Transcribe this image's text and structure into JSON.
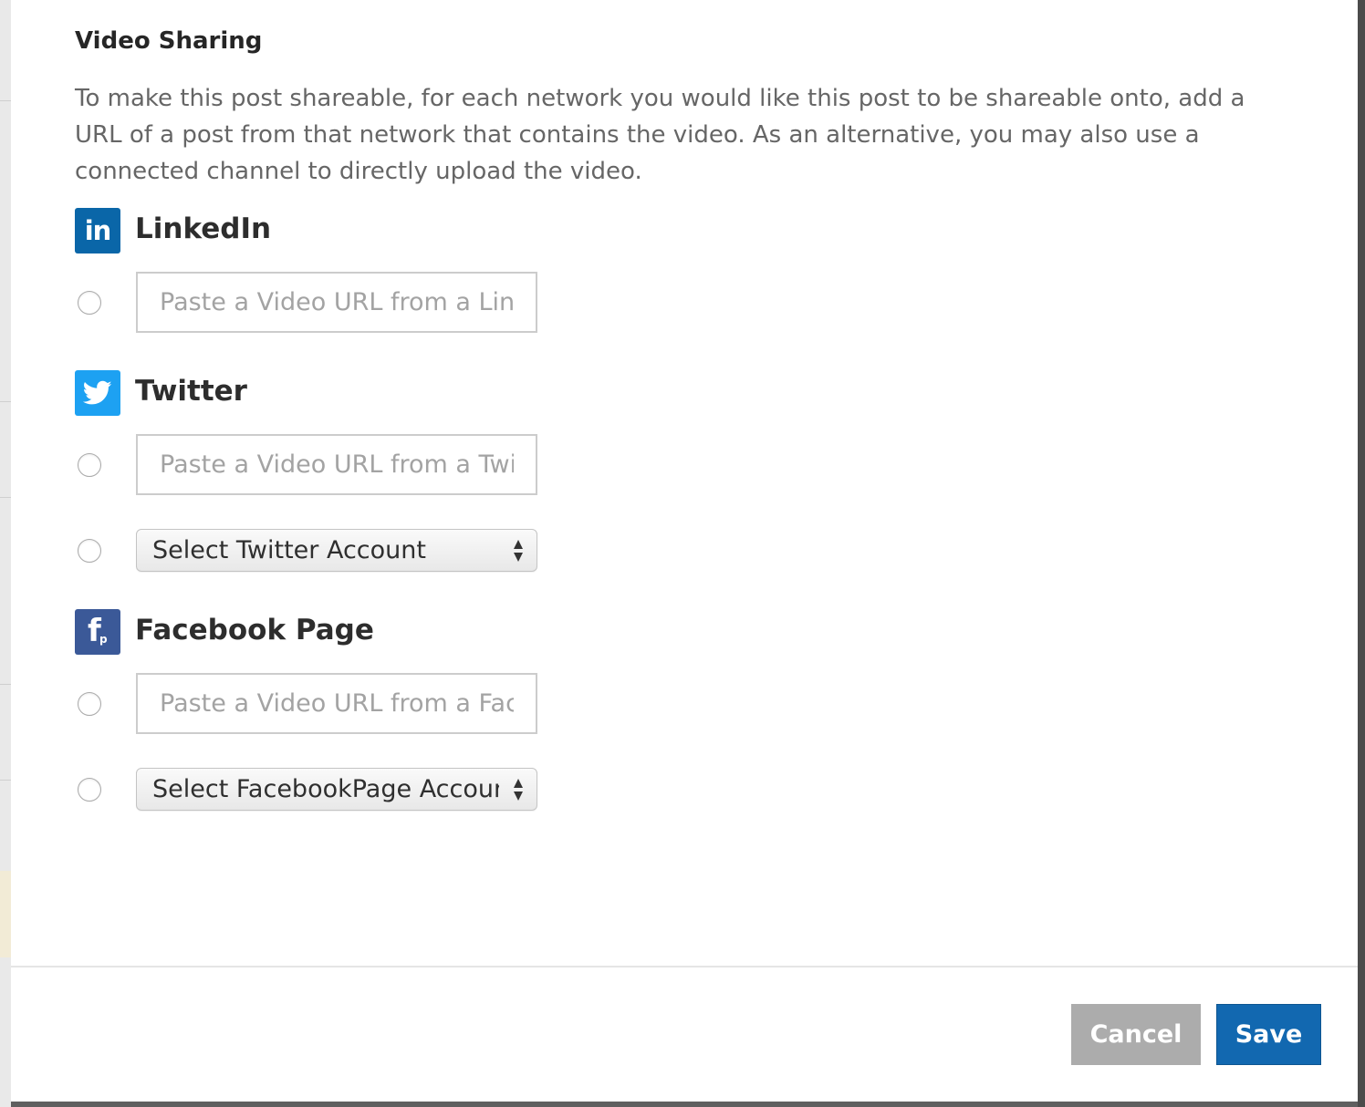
{
  "dialog": {
    "title": "Video Sharing",
    "description": "To make this post shareable, for each network you would like this post to be shareable onto, add a URL of a post from that network that contains the video. As an alternative, you may also use a connected channel to directly upload the video."
  },
  "networks": {
    "linkedin": {
      "name": "LinkedIn",
      "icon": "linkedin-icon",
      "icon_text": "in",
      "color": "#0a66a8",
      "url_placeholder": "Paste a Video URL from a LinkedIn post"
    },
    "twitter": {
      "name": "Twitter",
      "icon": "twitter-bird-icon",
      "color": "#1da1f2",
      "url_placeholder": "Paste a Video URL from a Twitter post",
      "account_select": "Select Twitter Account"
    },
    "facebook": {
      "name": "Facebook Page",
      "icon": "facebook-page-icon",
      "icon_letter": "f",
      "icon_sub": "p",
      "color": "#3b5998",
      "url_placeholder": "Paste a Video URL from a Facebook post",
      "account_select": "Select FacebookPage Account"
    }
  },
  "footer": {
    "cancel_label": "Cancel",
    "save_label": "Save"
  },
  "colors": {
    "accent": "#1268b0",
    "cancel_gray": "#acacac"
  }
}
